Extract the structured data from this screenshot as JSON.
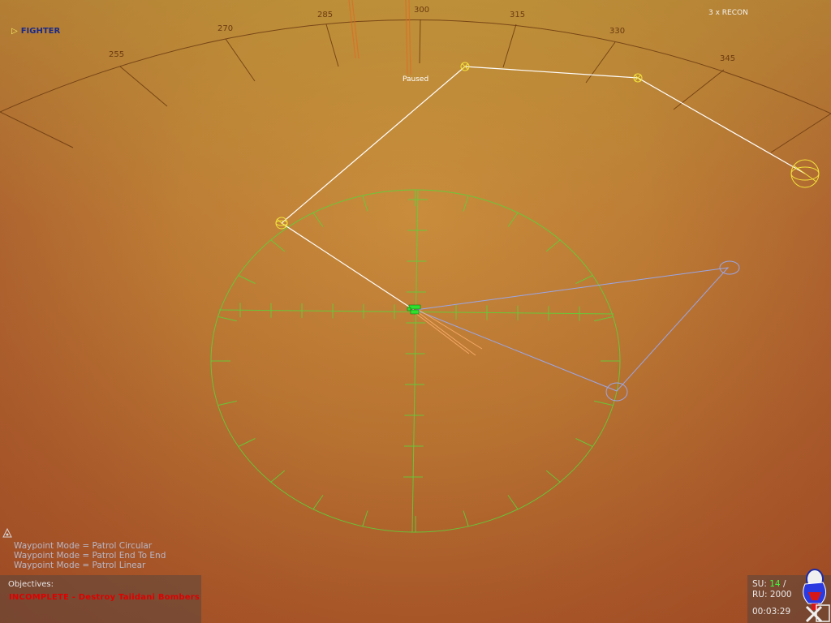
{
  "hud": {
    "selected_label": "FIGHTER",
    "selected_marker": "▷",
    "group_label": "3 x RECON",
    "status": "Paused"
  },
  "heading_ticks": [
    "255",
    "270",
    "285",
    "300",
    "315",
    "330",
    "345"
  ],
  "waypoint_modes": [
    "Waypoint Mode = Patrol Circular",
    "Waypoint Mode = Patrol End To End",
    "Waypoint Mode = Patrol Linear"
  ],
  "objectives": {
    "title": "Objectives:",
    "items": [
      {
        "status": "INCOMPLETE",
        "text": "INCOMPLETE - Destroy Taiidani Bombers"
      }
    ]
  },
  "resources": {
    "su_label": "SU:",
    "su_value": "14",
    "su_sep": " /",
    "ru_label": "RU:",
    "ru_value": "2000",
    "time": "00:03:29"
  },
  "icons": {
    "fighter_marker": "triangle-right-icon",
    "sensor_toggle": "triangle-outline-icon",
    "faction_emblem": "hiigaran-emblem-icon"
  },
  "colors": {
    "grid": "#5fcf3a",
    "waypoint_path": "#ffffff",
    "waypoint_marker": "#f2e23a",
    "move_path": "#9aa6e8",
    "heading_arc": "#6b3a10",
    "objective_incomplete": "#e00000",
    "su_value": "#40ff40"
  }
}
